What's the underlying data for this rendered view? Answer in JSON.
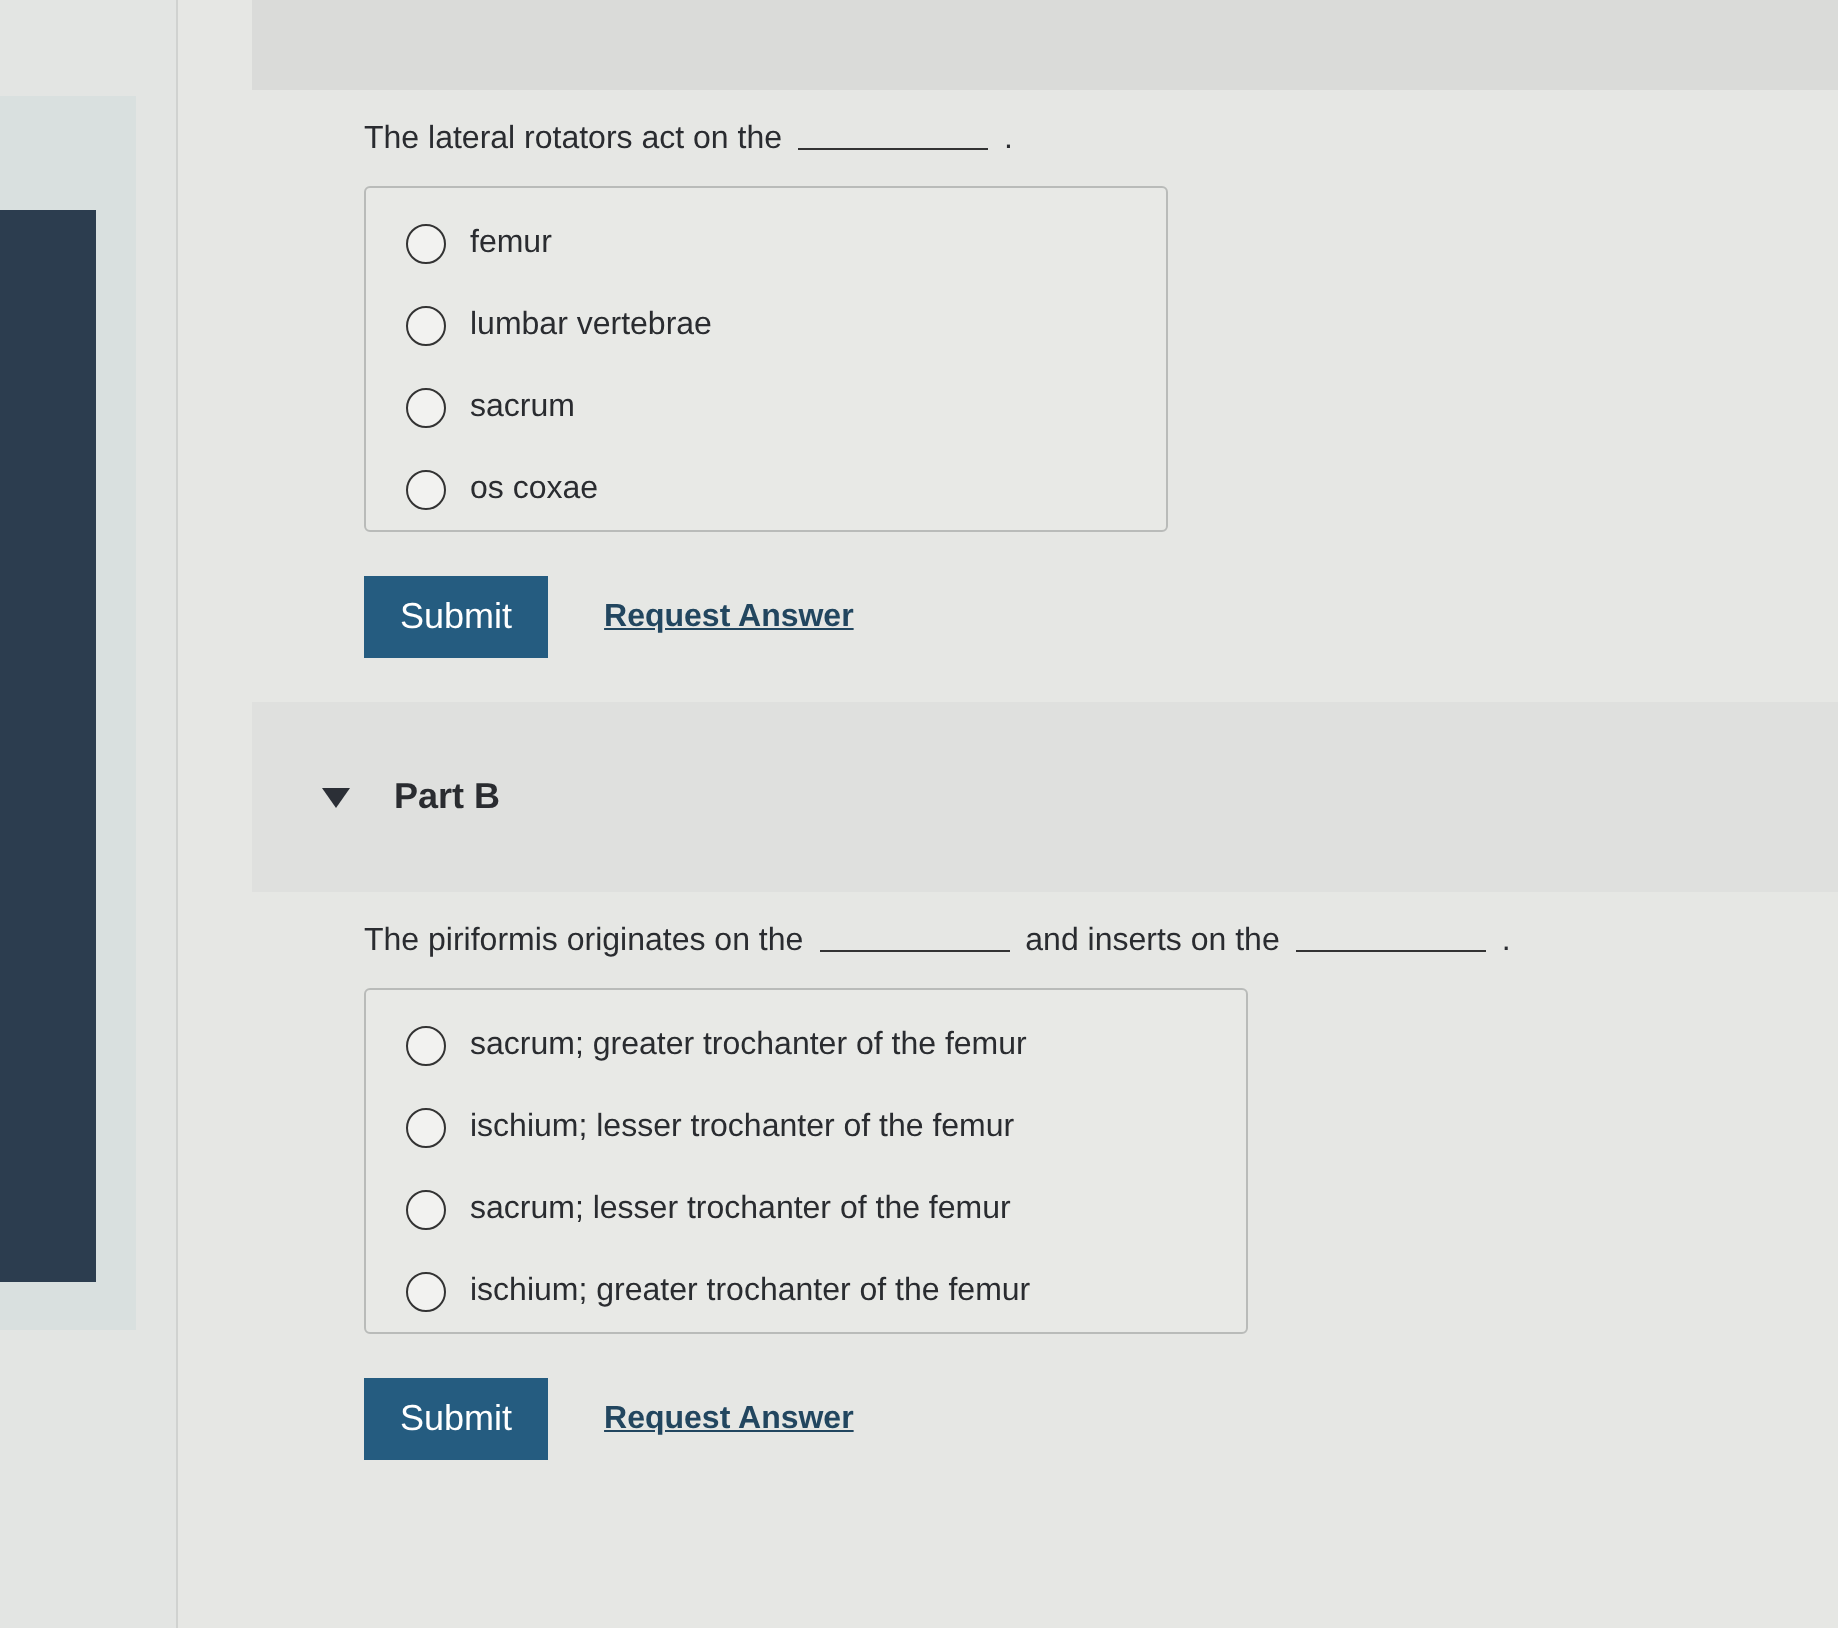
{
  "parts": [
    {
      "prompt": [
        {
          "kind": "text",
          "text": "The lateral rotators act on the"
        },
        {
          "kind": "blank"
        },
        {
          "kind": "text",
          "text": "."
        }
      ],
      "options": [
        {
          "label": "femur",
          "selected": false
        },
        {
          "label": "lumbar vertebrae",
          "selected": false
        },
        {
          "label": "sacrum",
          "selected": false
        },
        {
          "label": "os coxae",
          "selected": false
        }
      ],
      "submit": "Submit",
      "request": "Request Answer"
    },
    {
      "header": {
        "title": "Part B",
        "expanded": true
      },
      "prompt": [
        {
          "kind": "text",
          "text": "The piriformis originates on the"
        },
        {
          "kind": "blank"
        },
        {
          "kind": "text",
          "text": "and inserts on the"
        },
        {
          "kind": "blank"
        },
        {
          "kind": "text",
          "text": "."
        }
      ],
      "options": [
        {
          "label": "sacrum; greater trochanter of the femur",
          "selected": false
        },
        {
          "label": "ischium; lesser trochanter of the femur",
          "selected": false
        },
        {
          "label": "sacrum; lesser trochanter of the femur",
          "selected": false
        },
        {
          "label": "ischium; greater trochanter of the femur",
          "selected": false
        }
      ],
      "submit": "Submit",
      "request": "Request Answer"
    }
  ]
}
